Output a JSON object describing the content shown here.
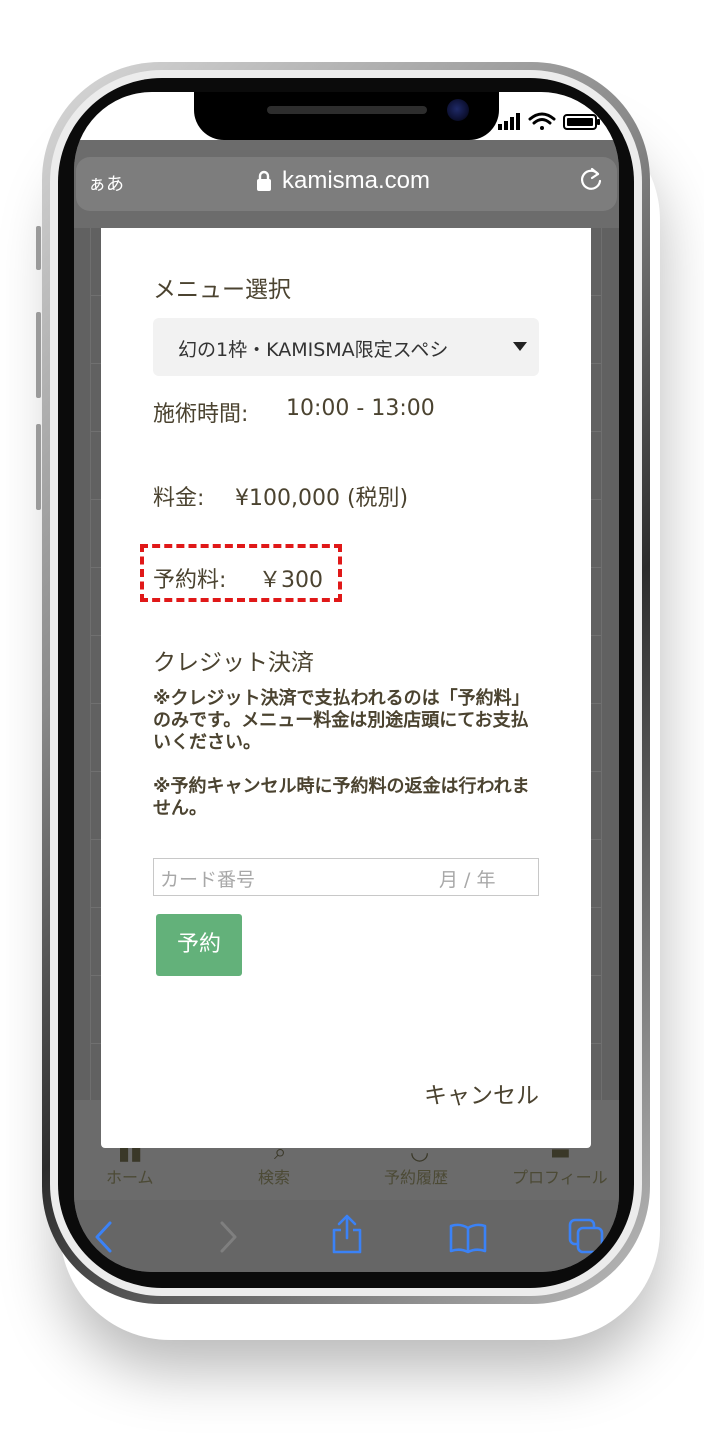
{
  "status_bar": {
    "icons": [
      "signal-icon",
      "wifi-icon",
      "battery-icon"
    ]
  },
  "browser": {
    "text_size_label": "ぁあ",
    "url": "kamisma.com"
  },
  "modal": {
    "menu_heading": "メニュー選択",
    "menu_select_value": "幻の1枠・KAMISMA限定スペシ",
    "time_label": "施術時間:",
    "time_value": "10:00 - 13:00",
    "fee_label": "料金:",
    "fee_value": "¥100,000 (税別)",
    "reservation_fee_label": "予約料:",
    "reservation_fee_value": "￥300",
    "credit_heading": "クレジット決済",
    "note1": "※クレジット決済で支払われるのは「予約料」のみです。メニュー料金は別途店頭にてお支払いください。",
    "note2": "※予約キャンセル時に予約料の返金は行われません。",
    "card_placeholder": "カード番号",
    "card_date_placeholder": "月 / 年",
    "reserve_button": "予約",
    "cancel_link": "キャンセル"
  },
  "tabbar": {
    "items": [
      {
        "label": "ホーム",
        "icon": "home-icon"
      },
      {
        "label": "検索",
        "icon": "search-icon"
      },
      {
        "label": "予約履歴",
        "icon": "history-icon"
      },
      {
        "label": "プロフィール",
        "icon": "profile-icon"
      }
    ]
  },
  "safari_toolbar": {
    "icons": [
      "back-icon",
      "forward-icon",
      "share-icon",
      "bookmarks-icon",
      "tabs-icon"
    ],
    "icon_color": "#3b82f6"
  },
  "colors": {
    "accent_green": "#63b17a",
    "highlight_red": "#e01818",
    "text_brown": "#4b4330"
  }
}
